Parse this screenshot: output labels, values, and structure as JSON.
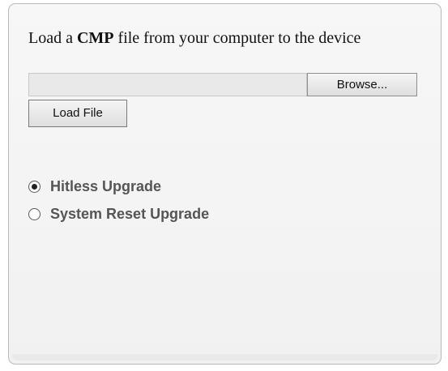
{
  "instruction": {
    "prefix": "Load a ",
    "bold": "CMP",
    "suffix": " file from your computer to the device"
  },
  "file_input": {
    "value": "",
    "browse_label": "Browse..."
  },
  "load_button_label": "Load File",
  "upgrade_options": [
    {
      "label": "Hitless Upgrade",
      "checked": true
    },
    {
      "label": "System Reset Upgrade",
      "checked": false
    }
  ]
}
